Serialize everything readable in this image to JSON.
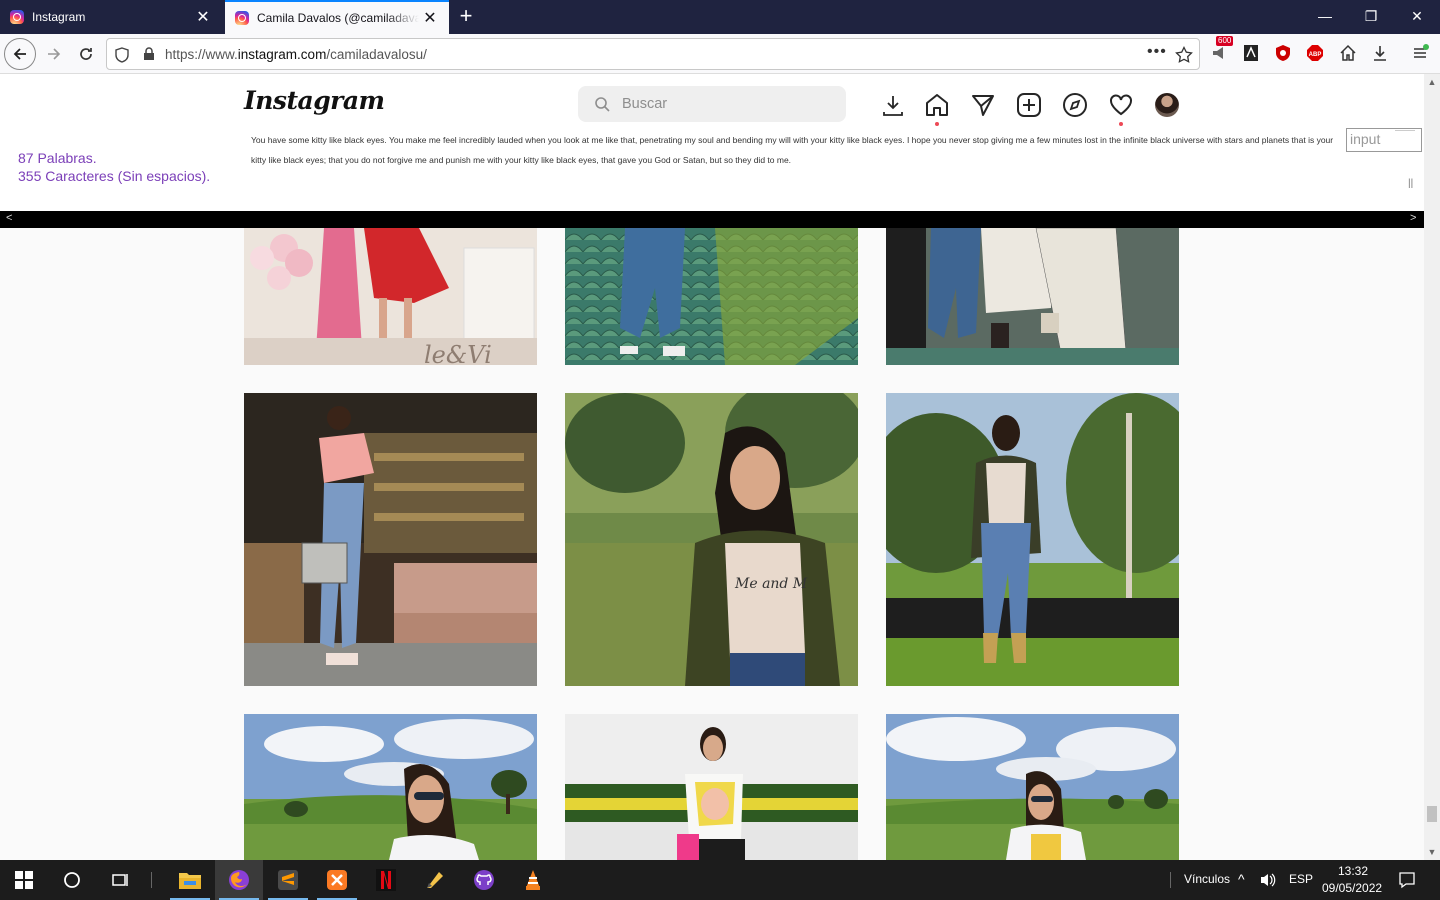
{
  "browser": {
    "tabs": [
      {
        "title": "Instagram",
        "active": false
      },
      {
        "title": "Camila Davalos (@camiladavalosu)",
        "active": true
      }
    ],
    "url_prefix": "https://www.",
    "url_host": "instagram.com",
    "url_path": "/camiladavalosu/",
    "badge_count": "600",
    "abp_label": "ABP"
  },
  "instagram": {
    "logo": "Instagram",
    "search_placeholder": "Buscar"
  },
  "extension_overlay": {
    "words": "87 Palabras.",
    "chars": "355 Caracteres (Sin espacios).",
    "text": "You have some kitty like black eyes. You make me feel incredibly lauded when you look at me like that, penetrating my soul and bending my will with your kitty like black eyes. I hope you never stop giving me a few minutes lost in the infinite black universe with stars and planets that is your kitty like black eyes; that you do not forgive me and punish me with your kitty like black eyes, that gave you God or Satan, but so they did to me.",
    "input_label": "input",
    "pause_symbol": "||",
    "left_arrow": "<",
    "right_arrow": ">"
  },
  "taskbar": {
    "links_label": "Vínculos",
    "language": "ESP",
    "time": "13:32",
    "date": "09/05/2022"
  },
  "colors": {
    "titlebar": "#1f2340",
    "accent": "#0a84ff",
    "overlay_text": "#7b3fb8",
    "notification_dot": "#ed4956"
  }
}
